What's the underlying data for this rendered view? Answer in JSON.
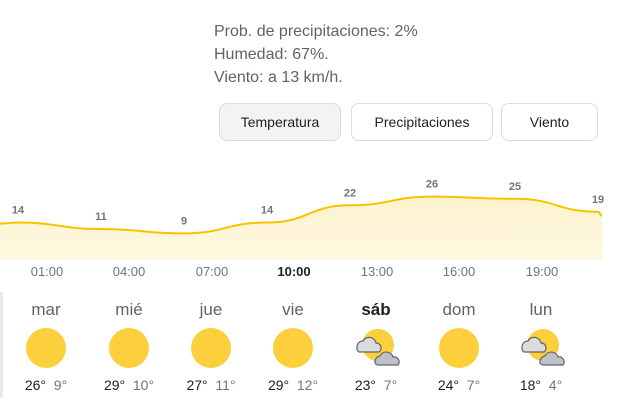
{
  "details": {
    "precipitation": "Prob. de precipitaciones: 2%",
    "humidity": "Humedad: 67%.",
    "wind": "Viento: a 13 km/h."
  },
  "tabs": [
    {
      "label": "Temperatura",
      "selected": true
    },
    {
      "label": "Precipitaciones",
      "selected": false
    },
    {
      "label": "Viento",
      "selected": false
    }
  ],
  "colors": {
    "line": "#f7c300",
    "fill": "#fdf3cc",
    "sun": "#fccf3d",
    "cloud": "#9aa0a6"
  },
  "chart_data": {
    "type": "area",
    "x": [
      "01:00",
      "04:00",
      "07:00",
      "10:00",
      "13:00",
      "16:00",
      "19:00"
    ],
    "labels": [
      14,
      11,
      9,
      14,
      22,
      26,
      25,
      19
    ],
    "values": [
      14,
      11,
      9,
      14,
      22,
      26,
      25,
      19
    ],
    "current_hour": "10:00"
  },
  "days": [
    {
      "name": "mar",
      "icon": "sun-icon",
      "max": "26°",
      "min": "9°"
    },
    {
      "name": "mié",
      "icon": "sun-icon",
      "max": "29°",
      "min": "10°"
    },
    {
      "name": "jue",
      "icon": "sun-icon",
      "max": "27°",
      "min": "11°"
    },
    {
      "name": "vie",
      "icon": "sun-icon",
      "max": "29°",
      "min": "12°"
    },
    {
      "name": "sáb",
      "icon": "partly-cloudy-icon",
      "max": "23°",
      "min": "7°",
      "selected": true
    },
    {
      "name": "dom",
      "icon": "sun-icon",
      "max": "24°",
      "min": "7°"
    },
    {
      "name": "lun",
      "icon": "partly-cloudy-icon",
      "max": "18°",
      "min": "4°"
    }
  ]
}
